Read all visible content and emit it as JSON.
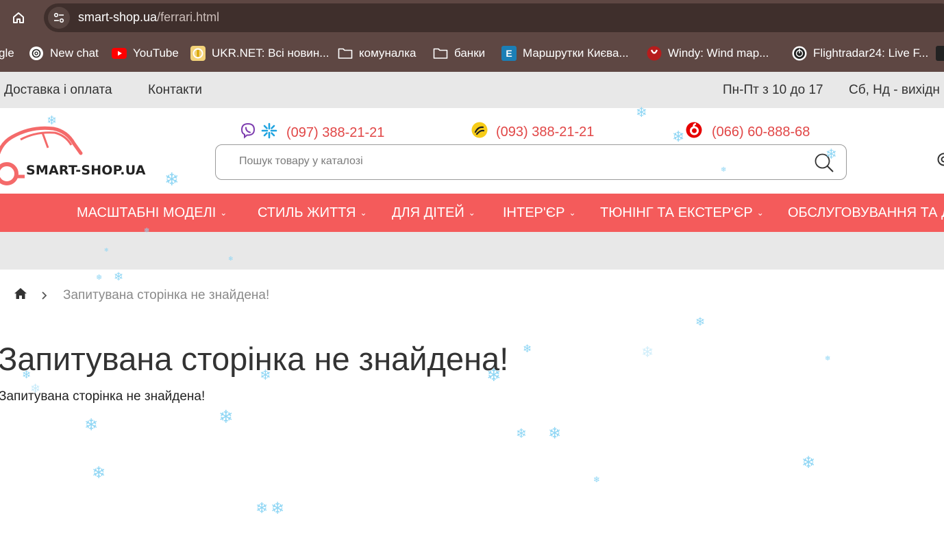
{
  "browser": {
    "url_host": "smart-shop.ua",
    "url_path": "/ferrari.html",
    "bookmarks": [
      {
        "label": "gle",
        "icon": "google-icon"
      },
      {
        "label": "New chat",
        "icon": "chatgpt-icon"
      },
      {
        "label": "YouTube",
        "icon": "youtube-icon"
      },
      {
        "label": "UKR.NET: Всі новин...",
        "icon": "ukrnet-icon"
      },
      {
        "label": "комуналка",
        "icon": "folder-icon"
      },
      {
        "label": "банки",
        "icon": "folder-icon"
      },
      {
        "label": "Маршрутки Києва...",
        "icon": "eway-icon"
      },
      {
        "label": "Windy: Wind map...",
        "icon": "windy-icon"
      },
      {
        "label": "Flightradar24: Live F...",
        "icon": "flightradar-icon"
      }
    ]
  },
  "topbar": {
    "delivery": "Доставка і оплата",
    "contacts": "Контакти",
    "hours_weekdays": "Пн-Пт з 10 до 17",
    "hours_weekend": "Сб, Нд - вихідн"
  },
  "header": {
    "logo_text": "SMART-SHOP.UA",
    "phones": [
      {
        "number": "(097) 388-21-21",
        "operators": [
          "viber-icon",
          "kyivstar-icon"
        ]
      },
      {
        "number": "(093) 388-21-21",
        "operators": [
          "lifecell-icon"
        ]
      },
      {
        "number": "(066) 60-888-68",
        "operators": [
          "vodafone-icon"
        ]
      }
    ],
    "search_placeholder": "Пошук товару у каталозі"
  },
  "nav": {
    "items": [
      {
        "label": "МАСШТАБНІ МОДЕЛІ",
        "has_dropdown": true
      },
      {
        "label": "СТИЛЬ ЖИТТЯ",
        "has_dropdown": true
      },
      {
        "label": "ДЛЯ ДІТЕЙ",
        "has_dropdown": true
      },
      {
        "label": "ІНТЕР'ЄР",
        "has_dropdown": true
      },
      {
        "label": "ТЮНІНГ ТА ЕКСТЕР'ЄР",
        "has_dropdown": true
      },
      {
        "label": "ОБСЛУГОВУВАННЯ ТА Д",
        "has_dropdown": false
      }
    ]
  },
  "breadcrumb": {
    "current": "Запитувана сторінка не знайдена!"
  },
  "content": {
    "title": "Запитувана сторінка не знайдена!",
    "message": "Запитувана сторінка не знайдена!"
  },
  "colors": {
    "browser_chrome": "#5e4743",
    "accent_red": "#f45b5b",
    "phone_red": "#e14646",
    "snow": "#8fd6f4"
  }
}
